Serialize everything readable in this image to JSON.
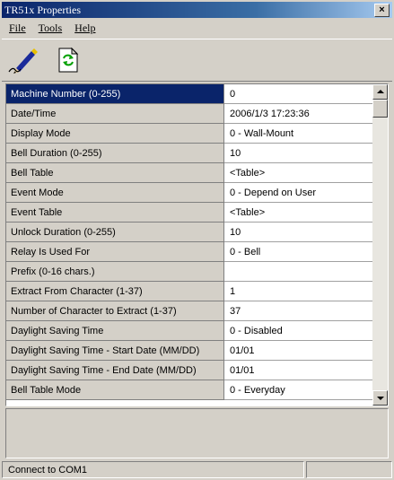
{
  "window": {
    "title": "TR51x Properties",
    "close_glyph": "×"
  },
  "menu": [
    {
      "label": "File"
    },
    {
      "label": "Tools"
    },
    {
      "label": "Help"
    }
  ],
  "toolbar": {
    "buttons": [
      {
        "icon": "pen-write-icon"
      },
      {
        "icon": "refresh-document-icon"
      }
    ]
  },
  "properties": [
    {
      "name": "Machine Number (0-255)",
      "value": "0"
    },
    {
      "name": "Date/Time",
      "value": "2006/1/3 17:23:36"
    },
    {
      "name": "Display Mode",
      "value": "0 - Wall-Mount"
    },
    {
      "name": "Bell Duration (0-255)",
      "value": "10"
    },
    {
      "name": "Bell Table",
      "value": "<Table>"
    },
    {
      "name": "Event Mode",
      "value": "0 - Depend on User"
    },
    {
      "name": "Event Table",
      "value": "<Table>"
    },
    {
      "name": "Unlock Duration (0-255)",
      "value": "10"
    },
    {
      "name": "Relay Is Used For",
      "value": "0 - Bell"
    },
    {
      "name": "Prefix (0-16 chars.)",
      "value": ""
    },
    {
      "name": "Extract From Character (1-37)",
      "value": "1"
    },
    {
      "name": "Number of Character to Extract (1-37)",
      "value": "37"
    },
    {
      "name": "Daylight Saving Time",
      "value": "0 - Disabled"
    },
    {
      "name": "Daylight Saving Time - Start Date (MM/DD)",
      "value": "01/01"
    },
    {
      "name": "Daylight Saving Time - End Date (MM/DD)",
      "value": "01/01"
    },
    {
      "name": "Bell Table Mode",
      "value": "0 - Everyday"
    }
  ],
  "description": "",
  "status": {
    "connection": "Connect to COM1",
    "secondary": ""
  },
  "colors": {
    "selection": "#0a246a",
    "window_face": "#d4d0c8",
    "title_gradient_start": "#0a246a",
    "title_gradient_end": "#a6caf0"
  }
}
